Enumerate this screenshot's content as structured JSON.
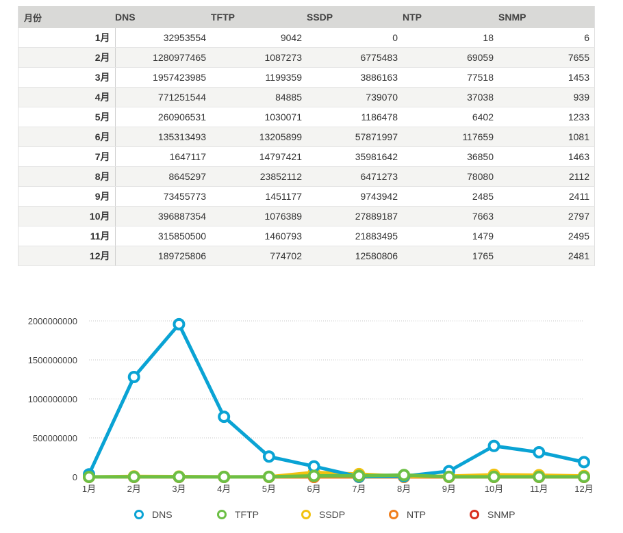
{
  "table": {
    "headers": [
      "月份",
      "DNS",
      "TFTP",
      "SSDP",
      "NTP",
      "SNMP"
    ],
    "rows": [
      [
        "1月",
        "32953554",
        "9042",
        "0",
        "18",
        "6"
      ],
      [
        "2月",
        "1280977465",
        "1087273",
        "6775483",
        "69059",
        "7655"
      ],
      [
        "3月",
        "1957423985",
        "1199359",
        "3886163",
        "77518",
        "1453"
      ],
      [
        "4月",
        "771251544",
        "84885",
        "739070",
        "37038",
        "939"
      ],
      [
        "5月",
        "260906531",
        "1030071",
        "1186478",
        "6402",
        "1233"
      ],
      [
        "6月",
        "135313493",
        "13205899",
        "57871997",
        "117659",
        "1081"
      ],
      [
        "7月",
        "1647117",
        "14797421",
        "35981642",
        "36850",
        "1463"
      ],
      [
        "8月",
        "8645297",
        "23852112",
        "6471273",
        "78080",
        "2112"
      ],
      [
        "9月",
        "73455773",
        "1451177",
        "9743942",
        "2485",
        "2411"
      ],
      [
        "10月",
        "396887354",
        "1076389",
        "27889187",
        "7663",
        "2797"
      ],
      [
        "11月",
        "315850500",
        "1460793",
        "21883495",
        "1479",
        "2495"
      ],
      [
        "12月",
        "189725806",
        "774702",
        "12580806",
        "1765",
        "2481"
      ]
    ]
  },
  "chart_data": {
    "type": "line",
    "categories": [
      "1月",
      "2月",
      "3月",
      "4月",
      "5月",
      "6月",
      "7月",
      "8月",
      "9月",
      "10月",
      "11月",
      "12月"
    ],
    "ylim": [
      0,
      2000000000
    ],
    "yticks": [
      "0",
      "500000000",
      "1000000000",
      "1500000000",
      "2000000000"
    ],
    "grid": true,
    "legend_position": "bottom",
    "series": [
      {
        "name": "DNS",
        "color": "#0aa3d4",
        "values": [
          32953554,
          1280977465,
          1957423985,
          771251544,
          260906531,
          135313493,
          1647117,
          8645297,
          73455773,
          396887354,
          315850500,
          189725806
        ]
      },
      {
        "name": "TFTP",
        "color": "#6cbf45",
        "values": [
          9042,
          1087273,
          1199359,
          84885,
          1030071,
          13205899,
          14797421,
          23852112,
          1451177,
          1076389,
          1460793,
          774702
        ]
      },
      {
        "name": "SSDP",
        "color": "#f2c210",
        "values": [
          0,
          6775483,
          3886163,
          739070,
          1186478,
          57871997,
          35981642,
          6471273,
          9743942,
          27889187,
          21883495,
          12580806
        ]
      },
      {
        "name": "NTP",
        "color": "#f07f1d",
        "values": [
          18,
          69059,
          77518,
          37038,
          6402,
          117659,
          36850,
          78080,
          2485,
          7663,
          1479,
          1765
        ]
      },
      {
        "name": "SNMP",
        "color": "#d9301f",
        "values": [
          6,
          7655,
          1453,
          939,
          1233,
          1081,
          1463,
          2112,
          2411,
          2797,
          2495,
          2481
        ]
      }
    ]
  }
}
